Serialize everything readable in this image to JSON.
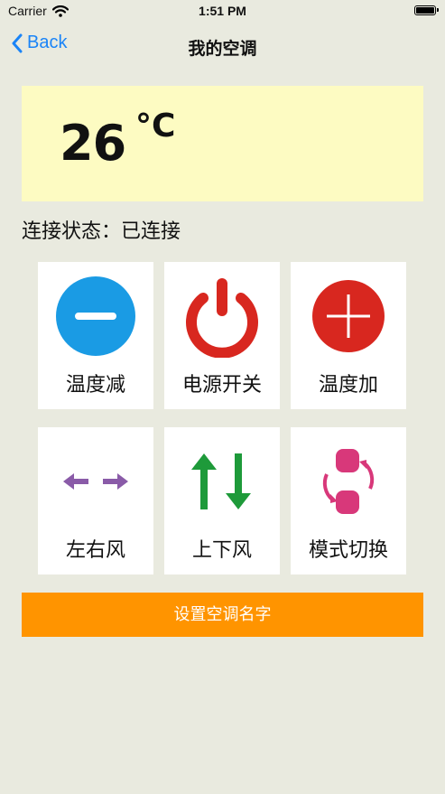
{
  "status_bar": {
    "carrier": "Carrier",
    "time": "1:51 PM"
  },
  "nav": {
    "back_label": "Back",
    "title": "我的空调"
  },
  "temperature": {
    "value": "26",
    "unit": "°C"
  },
  "connection": {
    "label": "连接状态：",
    "value": "已连接"
  },
  "controls": [
    {
      "label": "温度减",
      "icon": "minus-circle-icon",
      "color": "#1a9be4"
    },
    {
      "label": "电源开关",
      "icon": "power-icon",
      "color": "#d8271f"
    },
    {
      "label": "温度加",
      "icon": "plus-circle-icon",
      "color": "#d8271f"
    },
    {
      "label": "左右风",
      "icon": "left-right-arrows-icon",
      "color": "#8a5ba8"
    },
    {
      "label": "上下风",
      "icon": "up-down-arrows-icon",
      "color": "#1e9a3a"
    },
    {
      "label": "模式切换",
      "icon": "mode-cycle-icon",
      "color": "#d8387a"
    }
  ],
  "rename_button": {
    "label": "设置空调名字"
  },
  "colors": {
    "background": "#e9eadf",
    "temp_panel": "#fdfbc2",
    "accent": "#ff9400",
    "link": "#1a84f7"
  }
}
